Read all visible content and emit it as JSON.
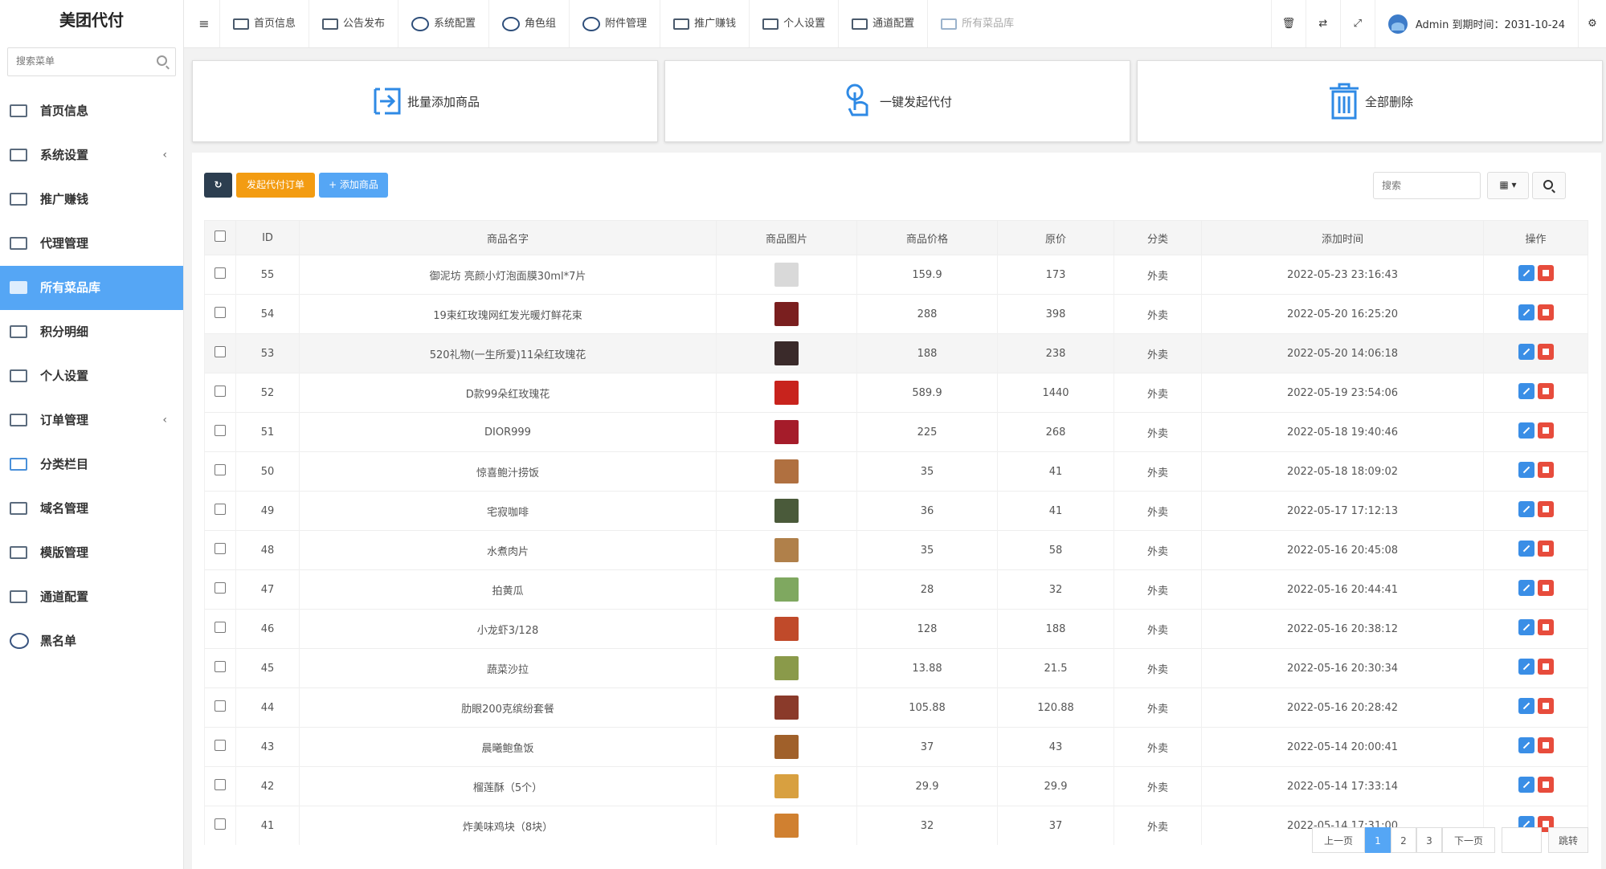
{
  "app": {
    "title": "美团代付"
  },
  "sidebar": {
    "search_placeholder": "搜索菜单",
    "items": [
      {
        "label": "首页信息",
        "icon": "dashboard-icon",
        "arrow": ""
      },
      {
        "label": "系统设置",
        "icon": "settings-panel-icon",
        "arrow": "‹"
      },
      {
        "label": "推广赚钱",
        "icon": "promotion-icon",
        "arrow": ""
      },
      {
        "label": "代理管理",
        "icon": "agent-icon",
        "arrow": ""
      },
      {
        "label": "所有菜品库",
        "icon": "dish-library-icon",
        "arrow": ""
      },
      {
        "label": "积分明细",
        "icon": "points-icon",
        "arrow": ""
      },
      {
        "label": "个人设置",
        "icon": "profile-settings-icon",
        "arrow": ""
      },
      {
        "label": "订单管理",
        "icon": "order-icon",
        "arrow": "‹"
      },
      {
        "label": "分类栏目",
        "icon": "category-icon",
        "arrow": ""
      },
      {
        "label": "域名管理",
        "icon": "domain-icon",
        "arrow": ""
      },
      {
        "label": "模版管理",
        "icon": "template-icon",
        "arrow": ""
      },
      {
        "label": "通道配置",
        "icon": "channel-icon",
        "arrow": ""
      },
      {
        "label": "黑名单",
        "icon": "blacklist-icon",
        "arrow": ""
      }
    ],
    "active_index": 4
  },
  "topbar": {
    "menu_icon": "≡",
    "tabs": [
      {
        "label": "首页信息",
        "icon": "dashboard-icon"
      },
      {
        "label": "公告发布",
        "icon": "announcement-icon"
      },
      {
        "label": "系统配置",
        "icon": "system-config-icon"
      },
      {
        "label": "角色组",
        "icon": "role-group-icon"
      },
      {
        "label": "附件管理",
        "icon": "attachment-icon"
      },
      {
        "label": "推广赚钱",
        "icon": "promotion-icon"
      },
      {
        "label": "个人设置",
        "icon": "profile-settings-icon"
      },
      {
        "label": "通道配置",
        "icon": "channel-icon"
      },
      {
        "label": "所有菜品库",
        "icon": "dish-library-icon"
      }
    ],
    "actions": [
      {
        "glyph": "🗑",
        "icon": "trash-icon"
      },
      {
        "glyph": "⇄",
        "icon": "translate-icon"
      },
      {
        "glyph": "⤢",
        "icon": "fullscreen-icon"
      }
    ],
    "user": {
      "text": "Admin 到期时间：2031-10-24"
    },
    "settings_glyph": "⚙"
  },
  "cards": [
    {
      "label": "批量添加商品",
      "icon": "import-icon"
    },
    {
      "label": "一键发起代付",
      "icon": "tap-icon"
    },
    {
      "label": "全部删除",
      "icon": "trash-icon"
    }
  ],
  "toolbar": {
    "refresh_glyph": "↻",
    "launch_label": "发起代付订单",
    "add_label": "+ 添加商品",
    "search_placeholder": "搜索",
    "columns_glyph": "▦ ▾"
  },
  "table": {
    "headers": [
      "ID",
      "商品名字",
      "商品图片",
      "商品价格",
      "原价",
      "分类",
      "添加时间",
      "操作"
    ],
    "rows": [
      {
        "id": "55",
        "name": "御泥坊 亮颜小灯泡面膜30ml*7片",
        "price": "159.9",
        "original": "173",
        "category": "外卖",
        "time": "2022-05-23 23:16:43",
        "img": "#d9d9d9"
      },
      {
        "id": "54",
        "name": "19束红玫瑰网红发光暖灯鲜花束",
        "price": "288",
        "original": "398",
        "category": "外卖",
        "time": "2022-05-20 16:25:20",
        "img": "#7a1f1f"
      },
      {
        "id": "53",
        "name": "520礼物(一生所爱)11朵红玫瑰花",
        "price": "188",
        "original": "238",
        "category": "外卖",
        "time": "2022-05-20 14:06:18",
        "img": "#3a2a2a"
      },
      {
        "id": "52",
        "name": "D款99朵红玫瑰花",
        "price": "589.9",
        "original": "1440",
        "category": "外卖",
        "time": "2022-05-19 23:54:06",
        "img": "#c8231d"
      },
      {
        "id": "51",
        "name": "DIOR999",
        "price": "225",
        "original": "268",
        "category": "外卖",
        "time": "2022-05-18 19:40:46",
        "img": "#a51c2a"
      },
      {
        "id": "50",
        "name": "惊喜鲍汁捞饭",
        "price": "35",
        "original": "41",
        "category": "外卖",
        "time": "2022-05-18 18:09:02",
        "img": "#b07040"
      },
      {
        "id": "49",
        "name": "宅寂咖啡",
        "price": "36",
        "original": "41",
        "category": "外卖",
        "time": "2022-05-17 17:12:13",
        "img": "#4a5a3a"
      },
      {
        "id": "48",
        "name": "水煮肉片",
        "price": "35",
        "original": "58",
        "category": "外卖",
        "time": "2022-05-16 20:45:08",
        "img": "#b0804a"
      },
      {
        "id": "47",
        "name": "拍黄瓜",
        "price": "28",
        "original": "32",
        "category": "外卖",
        "time": "2022-05-16 20:44:41",
        "img": "#7fa860"
      },
      {
        "id": "46",
        "name": "小龙虾3/128",
        "price": "128",
        "original": "188",
        "category": "外卖",
        "time": "2022-05-16 20:38:12",
        "img": "#c04a2a"
      },
      {
        "id": "45",
        "name": "蔬菜沙拉",
        "price": "13.88",
        "original": "21.5",
        "category": "外卖",
        "time": "2022-05-16 20:30:34",
        "img": "#8a9a4a"
      },
      {
        "id": "44",
        "name": "肋眼200克缤纷套餐",
        "price": "105.88",
        "original": "120.88",
        "category": "外卖",
        "time": "2022-05-16 20:28:42",
        "img": "#8a3a2a"
      },
      {
        "id": "43",
        "name": "晨曦鲍鱼饭",
        "price": "37",
        "original": "43",
        "category": "外卖",
        "time": "2022-05-14 20:00:41",
        "img": "#a0602a"
      },
      {
        "id": "42",
        "name": "榴莲酥（5个）",
        "price": "29.9",
        "original": "29.9",
        "category": "外卖",
        "time": "2022-05-14 17:33:14",
        "img": "#d8a040"
      },
      {
        "id": "41",
        "name": "炸美味鸡块（8块）",
        "price": "32",
        "original": "37",
        "category": "外卖",
        "time": "2022-05-14 17:31:00",
        "img": "#d08030"
      }
    ],
    "highlight_row": 2
  },
  "pagination": {
    "prev": "上一页",
    "pages": [
      "1",
      "2",
      "3"
    ],
    "current": "1",
    "next": "下一页",
    "jump": "跳转"
  },
  "colors": {
    "accent": "#55a6f5",
    "orange": "#f39c12",
    "dark": "#2c3e50",
    "danger": "#e74c3c"
  }
}
